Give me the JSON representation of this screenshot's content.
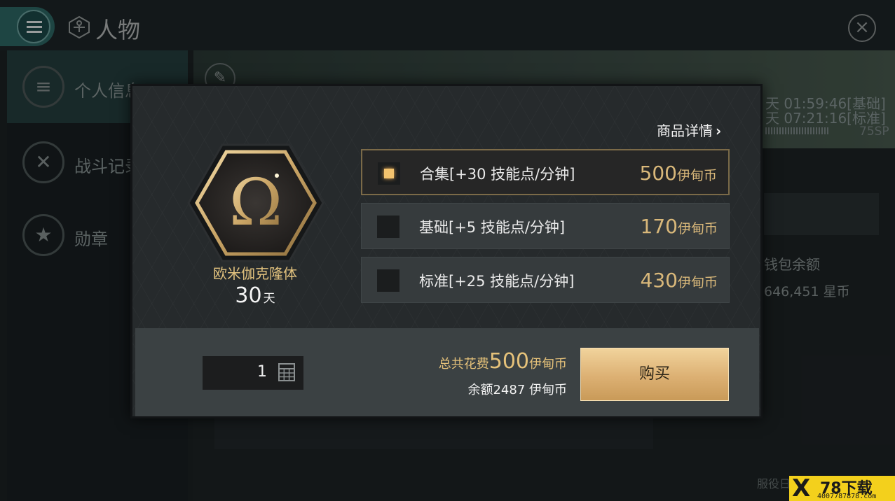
{
  "header": {
    "title": "人物",
    "menu_icon": "hamburger-icon",
    "close_icon": "close-icon"
  },
  "sidebar": {
    "items": [
      {
        "label": "个人信息",
        "icon": "list-icon"
      },
      {
        "label": "战斗记录",
        "icon": "crossed-swords-icon"
      },
      {
        "label": "勋章",
        "icon": "star-medal-icon"
      }
    ]
  },
  "background_info": {
    "timer_basic": "天 01:59:46[基础]",
    "timer_standard": "天 07:21:16[标准]",
    "sp": "75SP",
    "wallet_label": "钱包余额",
    "wallet_value": "646,451 星币",
    "footer": "服役日"
  },
  "modal": {
    "details_link": "商品详情",
    "product": {
      "name": "欧米伽克隆体",
      "duration_value": "30",
      "duration_unit": "天",
      "icon": "omega-icon"
    },
    "options": [
      {
        "label": "合集[+30 技能点/分钟]",
        "price": "500",
        "currency": "伊甸币",
        "selected": true
      },
      {
        "label": "基础[+5 技能点/分钟]",
        "price": "170",
        "currency": "伊甸币",
        "selected": false
      },
      {
        "label": "标准[+25 技能点/分钟]",
        "price": "430",
        "currency": "伊甸币",
        "selected": false
      }
    ],
    "quantity": "1",
    "total_label": "总共花费",
    "total_value": "500",
    "total_currency": "伊甸币",
    "balance_text": "余额2487 伊甸币",
    "buy_label": "购买"
  },
  "watermark": {
    "mark": "X",
    "title": "78下载",
    "site": "4007787878.com"
  },
  "colors": {
    "accent_gold": "#d9b87a",
    "teal": "#2f6a68",
    "button_gold": "#dcb073"
  }
}
